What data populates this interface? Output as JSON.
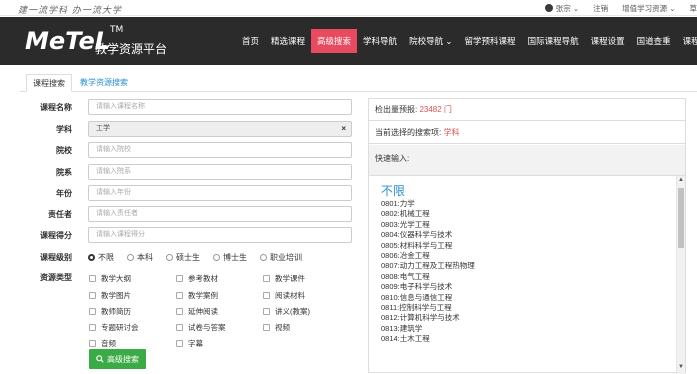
{
  "topbar": {
    "slogan": "建一流学科 办一流大学",
    "user": "张宗",
    "logout": "注销",
    "add_resource": "增值学习资源",
    "more": "草"
  },
  "header": {
    "logo": "MeTeL",
    "logo_tm": "TM",
    "subtitle": "教学资源平台",
    "nav": [
      "首页",
      "精选课程",
      "高级搜索",
      "学科导航",
      "院校导航 ⌄",
      "留学预科课程",
      "国际课程导航",
      "课程设置",
      "国道查重",
      "课程共建"
    ],
    "active_index": 2
  },
  "tabs": {
    "course_search": "课程搜索",
    "resource_search": "教学资源搜索"
  },
  "form": {
    "course_name": {
      "label": "课程名称",
      "placeholder": "请输入课程名称"
    },
    "subject": {
      "label": "学科",
      "value": "工学",
      "clear": "×"
    },
    "school": {
      "label": "院校",
      "placeholder": "请输入院校"
    },
    "department": {
      "label": "院系",
      "placeholder": "请输入院系"
    },
    "year": {
      "label": "年份",
      "placeholder": "请输入年份"
    },
    "owner": {
      "label": "责任者",
      "placeholder": "请输入责任者"
    },
    "score": {
      "label": "课程得分",
      "placeholder": "请输入课程得分"
    },
    "level": {
      "label": "课程级别",
      "options": [
        "不限",
        "本科",
        "硕士生",
        "博士生",
        "职业培训"
      ],
      "selected": 0
    },
    "resource_type": {
      "label": "资源类型",
      "options": [
        "教学大纲",
        "参考教材",
        "教学课件",
        "教学图片",
        "教学案例",
        "阅读材料",
        "教师简历",
        "延伸阅读",
        "讲义(教案)",
        "专题研讨会",
        "试卷与答案",
        "视频",
        "音频",
        "字幕"
      ]
    },
    "search_button": "高级搜索",
    "search_icon": "search-icon"
  },
  "panel": {
    "forecast_label": "检出量预报: ",
    "forecast_value": "23482 门",
    "current_label": "当前选择的搜索项: ",
    "current_value": "学科",
    "quick_label": "快速输入:",
    "quick_head": "不限",
    "quick_items": [
      "0801:力学",
      "0802:机械工程",
      "0803:光学工程",
      "0804:仪器科学与技术",
      "0805:材料科学与工程",
      "0806:冶金工程",
      "0807:动力工程及工程热物理",
      "0808:电气工程",
      "0809:电子科学与技术",
      "0810:信息与通信工程",
      "0811:控制科学与工程",
      "0812:计算机科学与技术",
      "0813:建筑学",
      "0814:土木工程"
    ]
  }
}
